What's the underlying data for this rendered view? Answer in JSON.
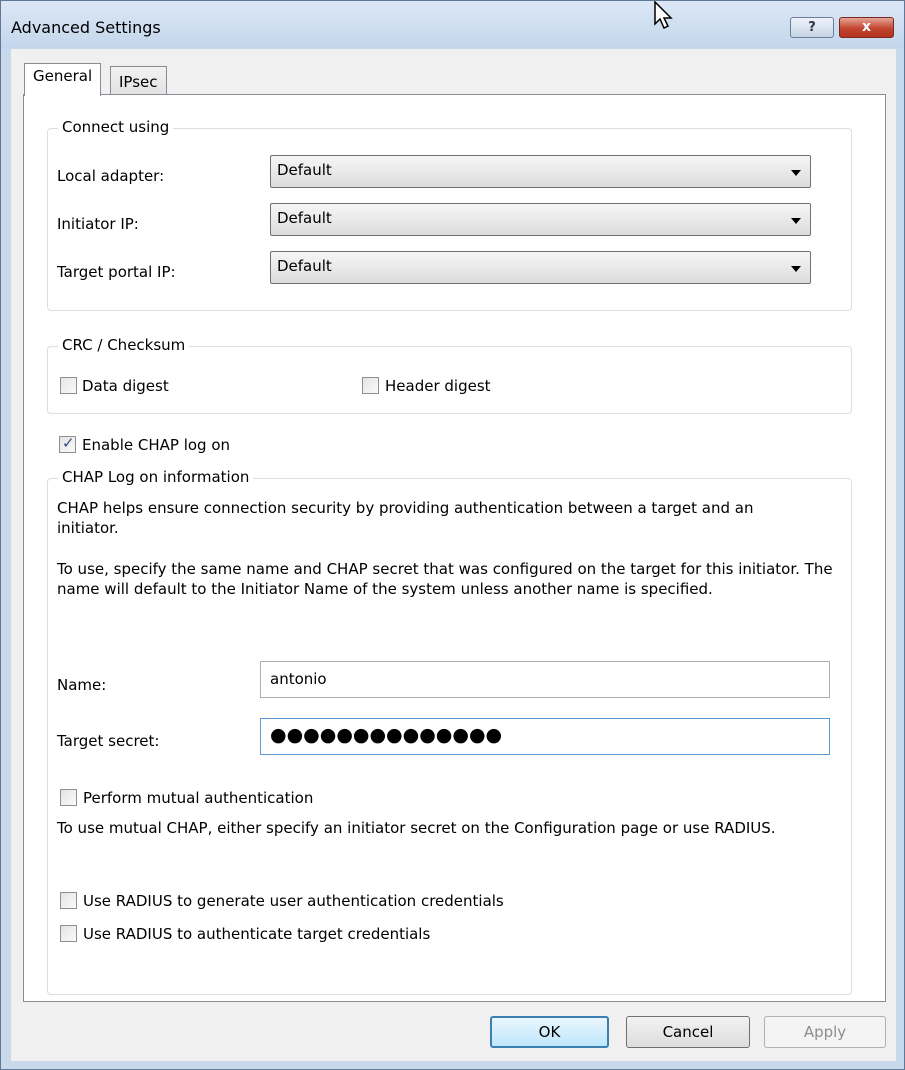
{
  "window": {
    "title": "Advanced Settings",
    "help_glyph": "?",
    "close_glyph": "x"
  },
  "tabs": [
    {
      "label": "General",
      "selected": true
    },
    {
      "label": "IPsec",
      "selected": false
    }
  ],
  "connect_using": {
    "legend": "Connect using",
    "local_adapter": {
      "label": "Local adapter:",
      "value": "Default"
    },
    "initiator_ip": {
      "label": "Initiator IP:",
      "value": "Default"
    },
    "target_portal_ip": {
      "label": "Target portal IP:",
      "value": "Default"
    }
  },
  "crc": {
    "legend": "CRC / Checksum",
    "data_digest": {
      "label": "Data digest",
      "checked": false
    },
    "header_digest": {
      "label": "Header digest",
      "checked": false
    }
  },
  "enable_chap": {
    "label": "Enable CHAP log on",
    "checked": true,
    "mark": "✓"
  },
  "chap": {
    "legend": "CHAP Log on information",
    "para1": "CHAP helps ensure connection security by providing authentication between a target and an initiator.",
    "para2": "To use, specify the same name and CHAP secret that was configured on the target for this initiator.  The name will default to the Initiator Name of the system unless another name is specified.",
    "name_label": "Name:",
    "name_value": "antonio",
    "secret_label": "Target secret:",
    "secret_value": "●●●●●●●●●●●●●●",
    "mutual": {
      "label": "Perform mutual authentication",
      "checked": false
    },
    "mutual_note": "To use mutual CHAP, either specify an initiator secret on the Configuration page or use RADIUS.",
    "radius_generate": {
      "label": "Use RADIUS to generate user authentication credentials",
      "checked": false
    },
    "radius_authenticate": {
      "label": "Use RADIUS to authenticate target credentials",
      "checked": false
    }
  },
  "buttons": {
    "ok": "OK",
    "cancel": "Cancel",
    "apply": "Apply"
  },
  "colors": {
    "accent": "#3c7fb1",
    "close_button": "#c2452f",
    "titlebar": "#c4d6ec"
  }
}
